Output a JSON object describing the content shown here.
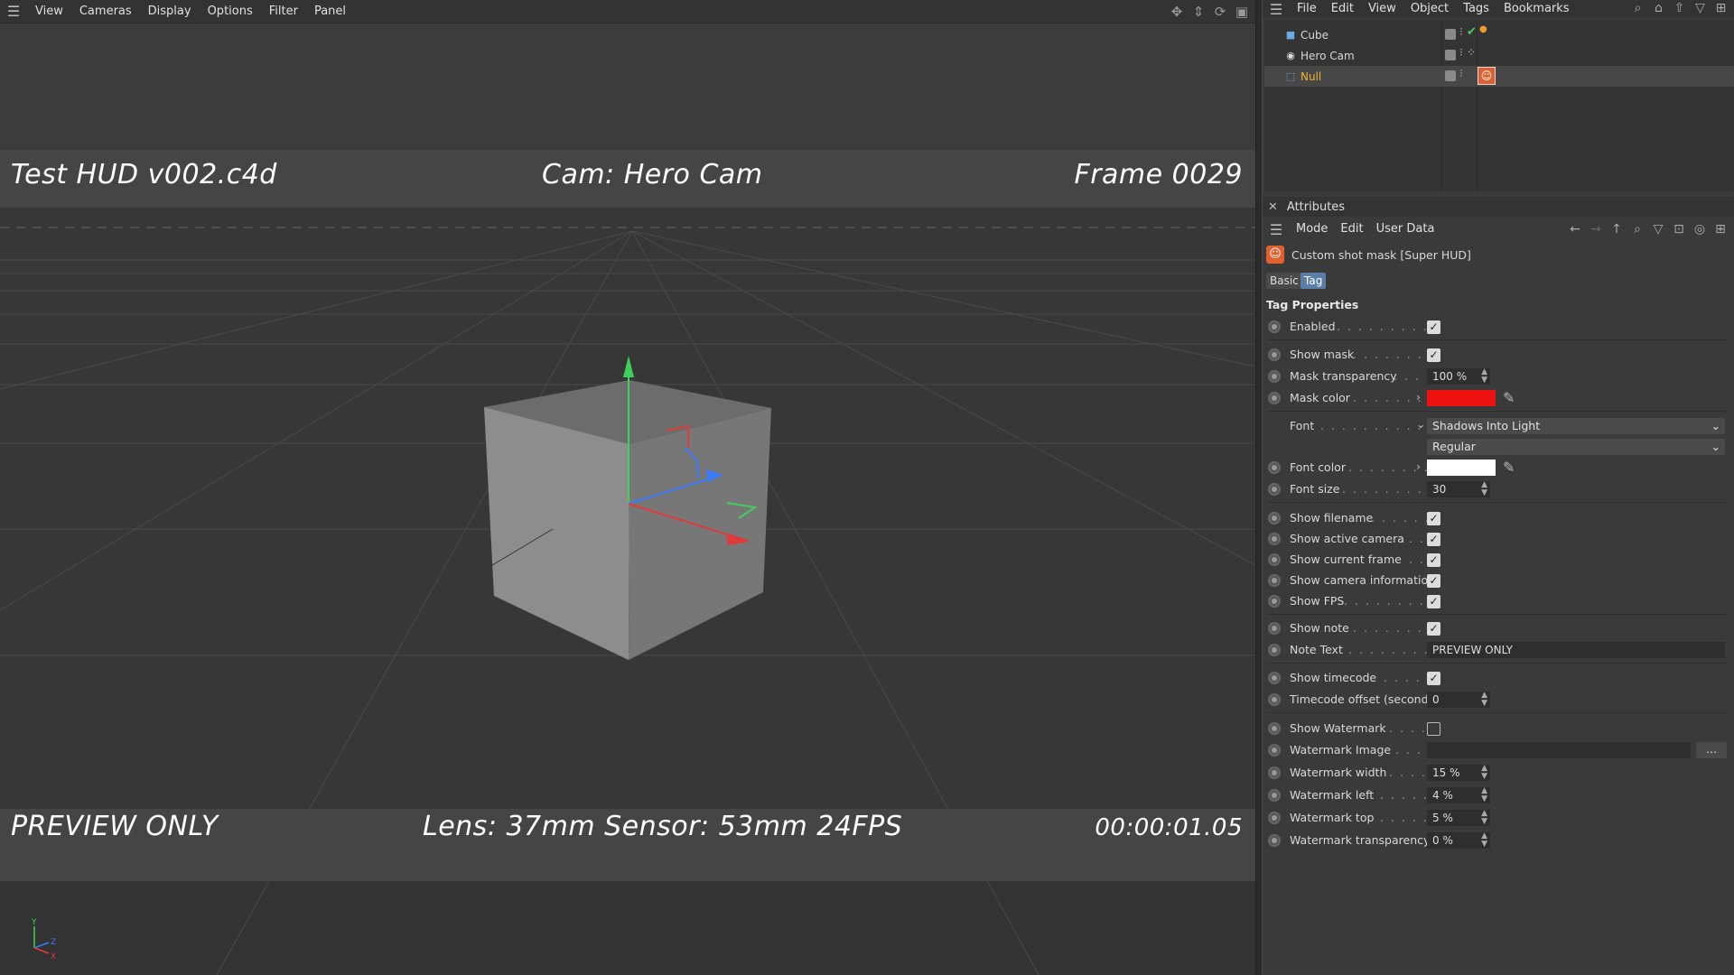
{
  "viewport": {
    "menu": [
      "View",
      "Cameras",
      "Display",
      "Options",
      "Filter",
      "Panel"
    ],
    "hud": {
      "filename": "Test HUD v002.c4d",
      "camera": "Cam: Hero Cam",
      "frame": "Frame 0029",
      "note": "PREVIEW ONLY",
      "info": "Lens: 37mm Sensor: 53mm 24FPS",
      "timecode": "00:00:01.05"
    },
    "axis_labels": {
      "y": "Y",
      "z": "Z",
      "x": "X"
    }
  },
  "object_manager": {
    "menu": [
      "File",
      "Edit",
      "View",
      "Object",
      "Tags",
      "Bookmarks"
    ],
    "objects": [
      {
        "name": "Cube",
        "icon": "cube-icon"
      },
      {
        "name": "Hero Cam",
        "icon": "camera-icon"
      },
      {
        "name": "Null",
        "icon": "null-icon",
        "selected": true
      }
    ]
  },
  "attributes": {
    "title": "Attributes",
    "menu": [
      "Mode",
      "Edit",
      "User Data"
    ],
    "object_title": "Custom shot mask [Super HUD]",
    "tabs": [
      "Basic",
      "Tag"
    ],
    "active_tab": "Tag",
    "section": "Tag Properties",
    "props": {
      "enabled": {
        "label": "Enabled",
        "checked": true
      },
      "show_mask": {
        "label": "Show mask",
        "checked": true
      },
      "mask_transparency": {
        "label": "Mask transparency",
        "value": "100 %"
      },
      "mask_color": {
        "label": "Mask color",
        "color": "#ee1111"
      },
      "font": {
        "label": "Font",
        "value": "Shadows Into Light",
        "style": "Regular"
      },
      "font_color": {
        "label": "Font color",
        "color": "#ffffff"
      },
      "font_size": {
        "label": "Font size",
        "value": "30"
      },
      "show_filename": {
        "label": "Show filename",
        "checked": true
      },
      "show_active_camera": {
        "label": "Show active camera",
        "checked": true
      },
      "show_current_frame": {
        "label": "Show current frame",
        "checked": true
      },
      "show_camera_information": {
        "label": "Show camera information",
        "checked": true
      },
      "show_fps": {
        "label": "Show FPS",
        "checked": true
      },
      "show_note": {
        "label": "Show note",
        "checked": true
      },
      "note_text": {
        "label": "Note Text",
        "value": "PREVIEW ONLY"
      },
      "show_timecode": {
        "label": "Show timecode",
        "checked": true
      },
      "timecode_offset": {
        "label": "Timecode offset (seconds)",
        "value": "0"
      },
      "show_watermark": {
        "label": "Show Watermark",
        "checked": false
      },
      "watermark_image": {
        "label": "Watermark Image",
        "value": "",
        "button": "..."
      },
      "watermark_width": {
        "label": "Watermark width",
        "value": "15 %"
      },
      "watermark_left": {
        "label": "Watermark left",
        "value": "4 %"
      },
      "watermark_top": {
        "label": "Watermark top",
        "value": "5 %"
      },
      "watermark_transparency": {
        "label": "Watermark transparency",
        "value": "0 %"
      }
    }
  }
}
